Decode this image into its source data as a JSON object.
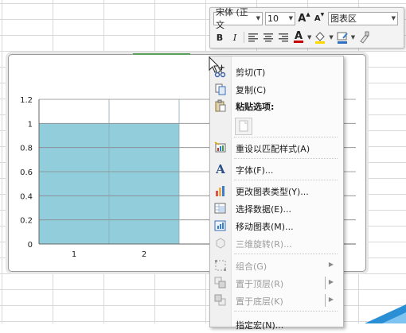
{
  "chart_data": {
    "type": "bar",
    "categories": [
      "1",
      "2"
    ],
    "values": [
      1,
      1
    ],
    "y_ticks": [
      "0",
      "0.2",
      "0.4",
      "0.6",
      "0.8",
      "1",
      "1.2"
    ],
    "ylim": [
      0,
      1.2
    ],
    "grid": true,
    "bar_color": "#92cddc"
  },
  "mini_toolbar": {
    "font_name": "宋体 (正文",
    "font_size": "10",
    "grow_font": "A",
    "shrink_font": "A",
    "chart_element": "图表区",
    "bold": "B",
    "italic": "I",
    "font_color_letter": "A"
  },
  "context_menu": {
    "cut": "剪切(T)",
    "copy": "复制(C)",
    "paste_options": "粘贴选项:",
    "reset_style": "重设以匹配样式(A)",
    "font": "字体(F)...",
    "change_chart_type": "更改图表类型(Y)...",
    "select_data": "选择数据(E)...",
    "move_chart": "移动图表(M)...",
    "rotate_3d": "三维旋转(R)...",
    "group": "组合(G)",
    "bring_front": "置于顶层(R)",
    "send_back": "置于底层(K)",
    "partial": "指定宏(N)..."
  },
  "colors": {
    "accent_red": "#cc0000",
    "highlight_yellow": "#ffd800",
    "bar_blue": "#92cddc",
    "stripe_blue": "#2b8fd6"
  }
}
